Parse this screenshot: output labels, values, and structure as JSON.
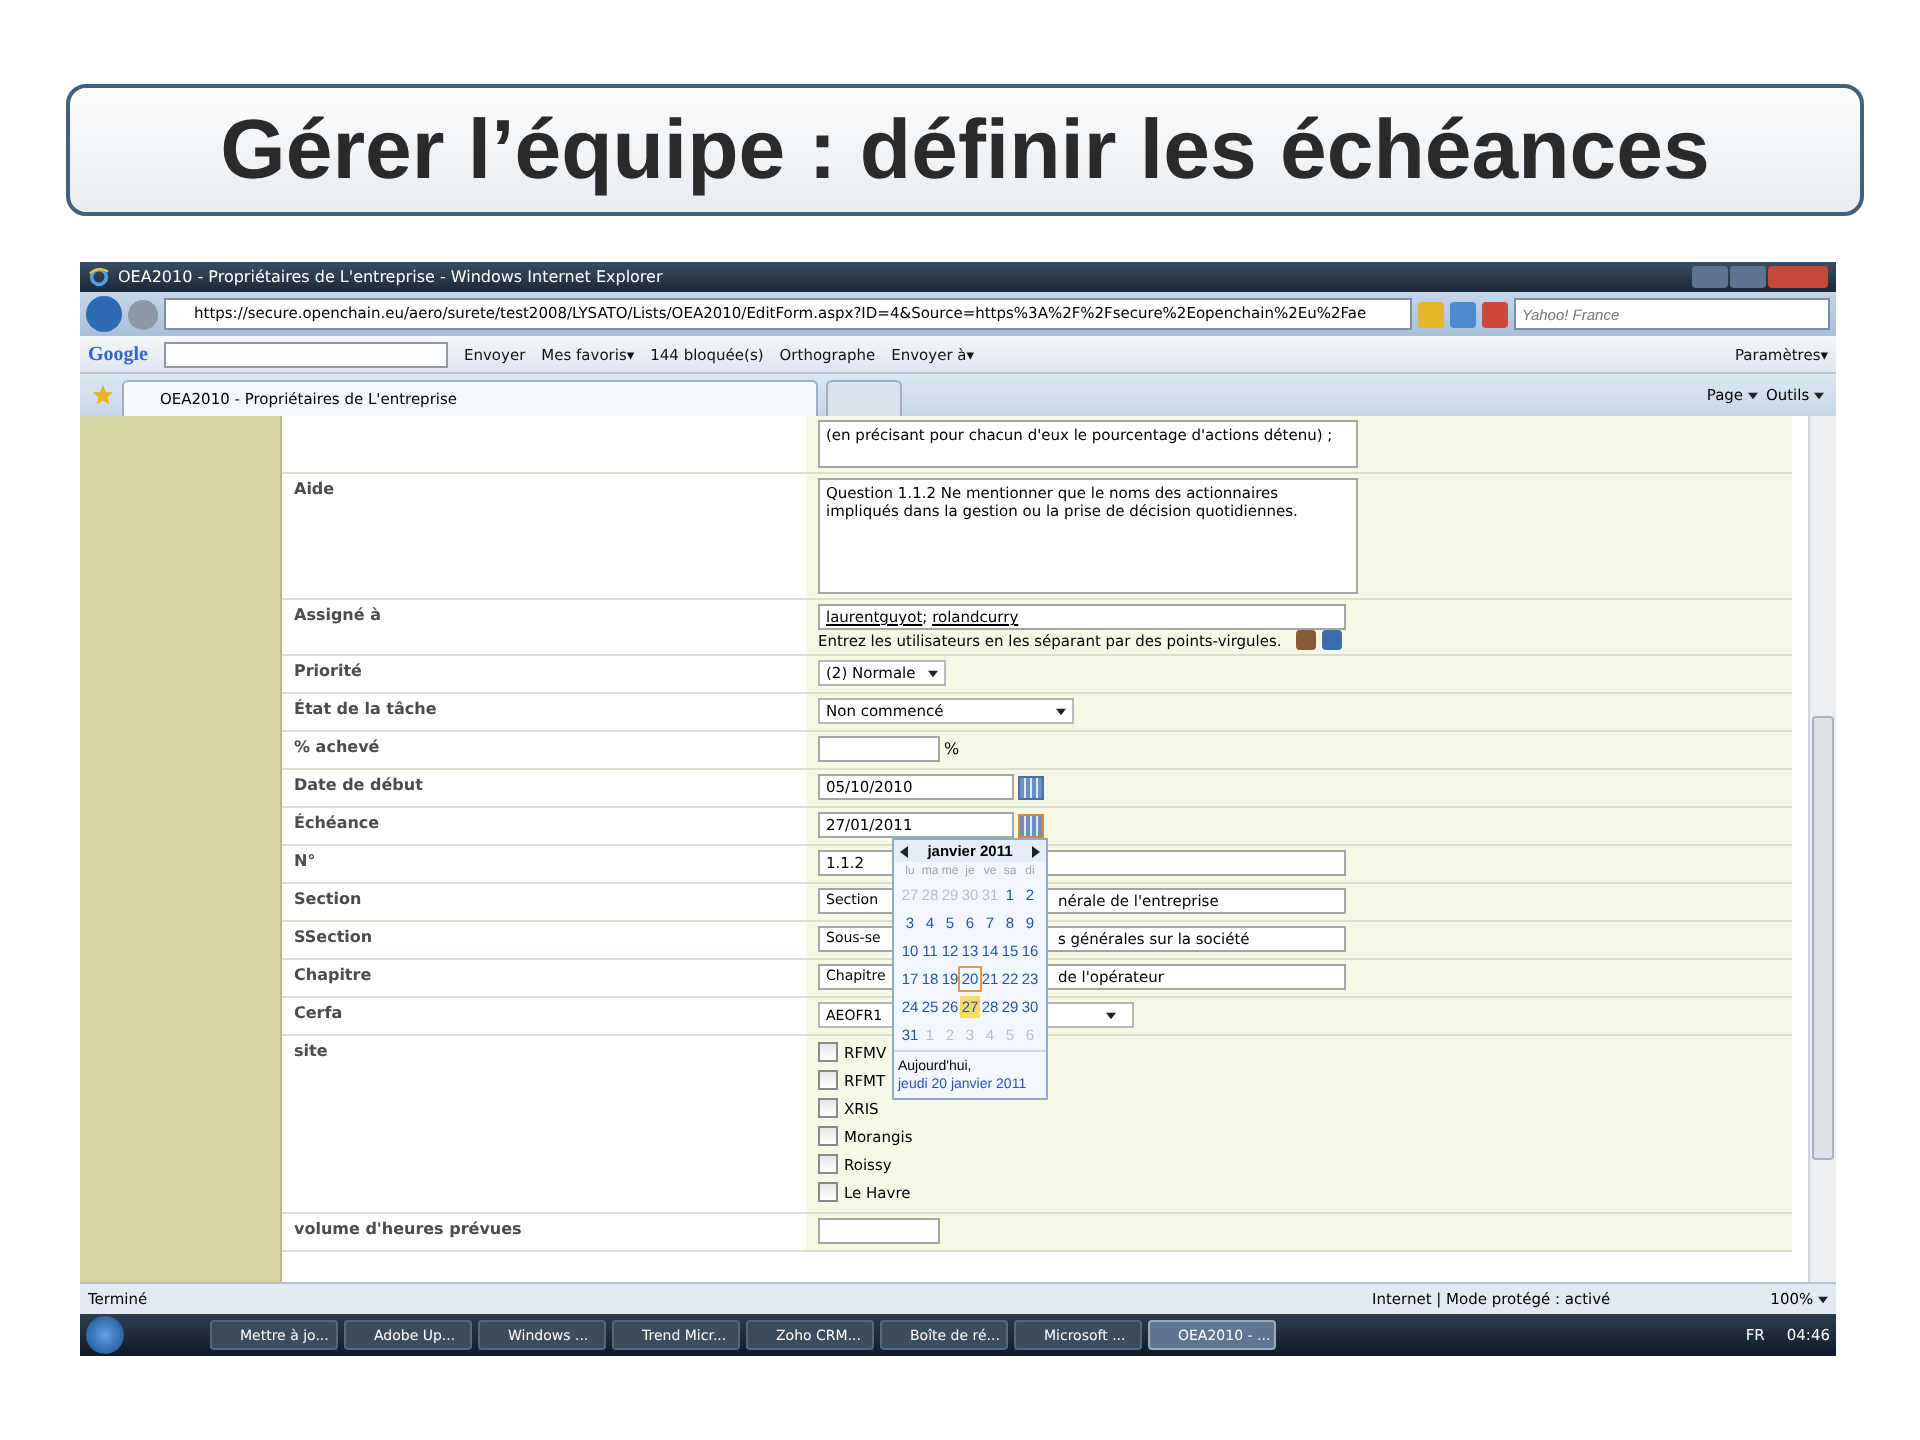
{
  "slide": {
    "title": "Gérer l’équipe : définir les échéances"
  },
  "window": {
    "title": "OEA2010 - Propriétaires de L'entreprise - Windows Internet Explorer"
  },
  "address_bar": {
    "url": "https://secure.openchain.eu/aero/surete/test2008/LYSATO/Lists/OEA2010/EditForm.aspx?ID=4&Source=https%3A%2F%2Fsecure%2Eopenchain%2Eu%2Fae",
    "search_placeholder": "Yahoo! France"
  },
  "google_toolbar": {
    "logo": "Google",
    "items": [
      "Envoyer",
      "Mes favoris▾",
      "144 bloquée(s)",
      "Orthographe",
      "Envoyer à▾"
    ],
    "settings": "Paramètres▾"
  },
  "tabs": [
    {
      "label": "OEA2010 - Propriétaires de L'entreprise",
      "selected": true
    },
    {
      "selected": false
    }
  ],
  "command_bar": [
    "Page",
    "Outils"
  ],
  "form": {
    "rows": [
      {
        "kind": "textarea",
        "label": "",
        "value": "(en précisant pour chacun d'eux le pourcentage d'actions détenu) ;"
      },
      {
        "kind": "textarea",
        "label": "Aide",
        "value": "Question 1.1.2 Ne mentionner que le noms des actionnaires impliqués dans la gestion ou la prise de décision quotidiennes."
      },
      {
        "kind": "people",
        "label": "Assigné à",
        "people": [
          "laurentguyot",
          "rolandcurry"
        ],
        "separator": ";",
        "hint": "Entrez les utilisateurs en les séparant par des points-virgules."
      },
      {
        "kind": "select",
        "label": "Priorité",
        "value": "(2) Normale"
      },
      {
        "kind": "select",
        "label": "État de la tâche",
        "value": "Non commencé"
      },
      {
        "kind": "percent",
        "label": "% achevé",
        "value": "",
        "unit": "%"
      },
      {
        "kind": "date",
        "label": "Date de début",
        "value": "05/10/2010",
        "picker_open": false
      },
      {
        "kind": "date",
        "label": "Échéance",
        "value": "27/01/2011",
        "picker_open": true
      },
      {
        "kind": "text",
        "label": "N°",
        "value": "1.1.2"
      },
      {
        "kind": "split_text",
        "label": "Section",
        "parts": [
          "Section",
          "nérale de l'entreprise"
        ]
      },
      {
        "kind": "split_text",
        "label": "SSection",
        "parts": [
          "Sous-se",
          "s générales sur la société"
        ]
      },
      {
        "kind": "split_text",
        "label": "Chapitre",
        "parts": [
          "Chapitre",
          "de l'opérateur"
        ]
      },
      {
        "kind": "split_select",
        "label": "Cerfa",
        "value": "AEOFR1"
      },
      {
        "kind": "checkboxes",
        "label": "site",
        "options": [
          {
            "label": "RFMV",
            "checked": false
          },
          {
            "label": "RFMT",
            "checked": false
          },
          {
            "label": "XRIS",
            "checked": false
          },
          {
            "label": "Morangis",
            "checked": false
          },
          {
            "label": "Roissy",
            "checked": false
          },
          {
            "label": "Le Havre",
            "checked": false
          }
        ]
      },
      {
        "kind": "text",
        "label": "volume d'heures prévues",
        "value": ""
      }
    ]
  },
  "calendar": {
    "month": "janvier 2011",
    "weekdays": [
      "lu",
      "ma",
      "me",
      "je",
      "ve",
      "sa",
      "di"
    ],
    "weeks": [
      [
        {
          "label": "27",
          "other_month": true,
          "today": false,
          "selected": false
        },
        {
          "label": "28",
          "other_month": true,
          "today": false,
          "selected": false
        },
        {
          "label": "29",
          "other_month": true,
          "today": false,
          "selected": false
        },
        {
          "label": "30",
          "other_month": true,
          "today": false,
          "selected": false
        },
        {
          "label": "31",
          "other_month": true,
          "today": false,
          "selected": false
        },
        {
          "label": "1",
          "other_month": false,
          "today": false,
          "selected": false
        },
        {
          "label": "2",
          "other_month": false,
          "today": false,
          "selected": false
        }
      ],
      [
        {
          "label": "3",
          "other_month": false,
          "today": false,
          "selected": false
        },
        {
          "label": "4",
          "other_month": false,
          "today": false,
          "selected": false
        },
        {
          "label": "5",
          "other_month": false,
          "today": false,
          "selected": false
        },
        {
          "label": "6",
          "other_month": false,
          "today": false,
          "selected": false
        },
        {
          "label": "7",
          "other_month": false,
          "today": false,
          "selected": false
        },
        {
          "label": "8",
          "other_month": false,
          "today": false,
          "selected": false
        },
        {
          "label": "9",
          "other_month": false,
          "today": false,
          "selected": false
        }
      ],
      [
        {
          "label": "10",
          "other_month": false,
          "today": false,
          "selected": false
        },
        {
          "label": "11",
          "other_month": false,
          "today": false,
          "selected": false
        },
        {
          "label": "12",
          "other_month": false,
          "today": false,
          "selected": false
        },
        {
          "label": "13",
          "other_month": false,
          "today": false,
          "selected": false
        },
        {
          "label": "14",
          "other_month": false,
          "today": false,
          "selected": false
        },
        {
          "label": "15",
          "other_month": false,
          "today": false,
          "selected": false
        },
        {
          "label": "16",
          "other_month": false,
          "today": false,
          "selected": false
        }
      ],
      [
        {
          "label": "17",
          "other_month": false,
          "today": false,
          "selected": false
        },
        {
          "label": "18",
          "other_month": false,
          "today": false,
          "selected": false
        },
        {
          "label": "19",
          "other_month": false,
          "today": false,
          "selected": false
        },
        {
          "label": "20",
          "other_month": false,
          "today": true,
          "selected": false
        },
        {
          "label": "21",
          "other_month": false,
          "today": false,
          "selected": false
        },
        {
          "label": "22",
          "other_month": false,
          "today": false,
          "selected": false
        },
        {
          "label": "23",
          "other_month": false,
          "today": false,
          "selected": false
        }
      ],
      [
        {
          "label": "24",
          "other_month": false,
          "today": false,
          "selected": false
        },
        {
          "label": "25",
          "other_month": false,
          "today": false,
          "selected": false
        },
        {
          "label": "26",
          "other_month": false,
          "today": false,
          "selected": false
        },
        {
          "label": "27",
          "other_month": false,
          "today": false,
          "selected": true
        },
        {
          "label": "28",
          "other_month": false,
          "today": false,
          "selected": false
        },
        {
          "label": "29",
          "other_month": false,
          "today": false,
          "selected": false
        },
        {
          "label": "30",
          "other_month": false,
          "today": false,
          "selected": false
        }
      ],
      [
        {
          "label": "31",
          "other_month": false,
          "today": false,
          "selected": false
        },
        {
          "label": "1",
          "other_month": true,
          "today": false,
          "selected": false
        },
        {
          "label": "2",
          "other_month": true,
          "today": false,
          "selected": false
        },
        {
          "label": "3",
          "other_month": true,
          "today": false,
          "selected": false
        },
        {
          "label": "4",
          "other_month": true,
          "today": false,
          "selected": false
        },
        {
          "label": "5",
          "other_month": true,
          "today": false,
          "selected": false
        },
        {
          "label": "6",
          "other_month": true,
          "today": false,
          "selected": false
        }
      ]
    ],
    "today_label": "Aujourd'hui,",
    "today_link": "jeudi 20 janvier 2011"
  },
  "status_bar": {
    "text": "Terminé",
    "zone": "Internet | Mode protégé : activé",
    "zoom": "100%"
  },
  "taskbar": {
    "items": [
      {
        "label": "Mettre à jo...",
        "selected": false
      },
      {
        "label": "Adobe Up...",
        "selected": false
      },
      {
        "label": "Windows ...",
        "selected": false
      },
      {
        "label": "Trend Micr...",
        "selected": false
      },
      {
        "label": "Zoho CRM...",
        "selected": false
      },
      {
        "label": "Boîte de ré...",
        "selected": false
      },
      {
        "label": "Microsoft ...",
        "selected": false
      },
      {
        "label": "OEA2010 - ...",
        "selected": true
      }
    ],
    "language": "FR",
    "clock": "04:46"
  }
}
